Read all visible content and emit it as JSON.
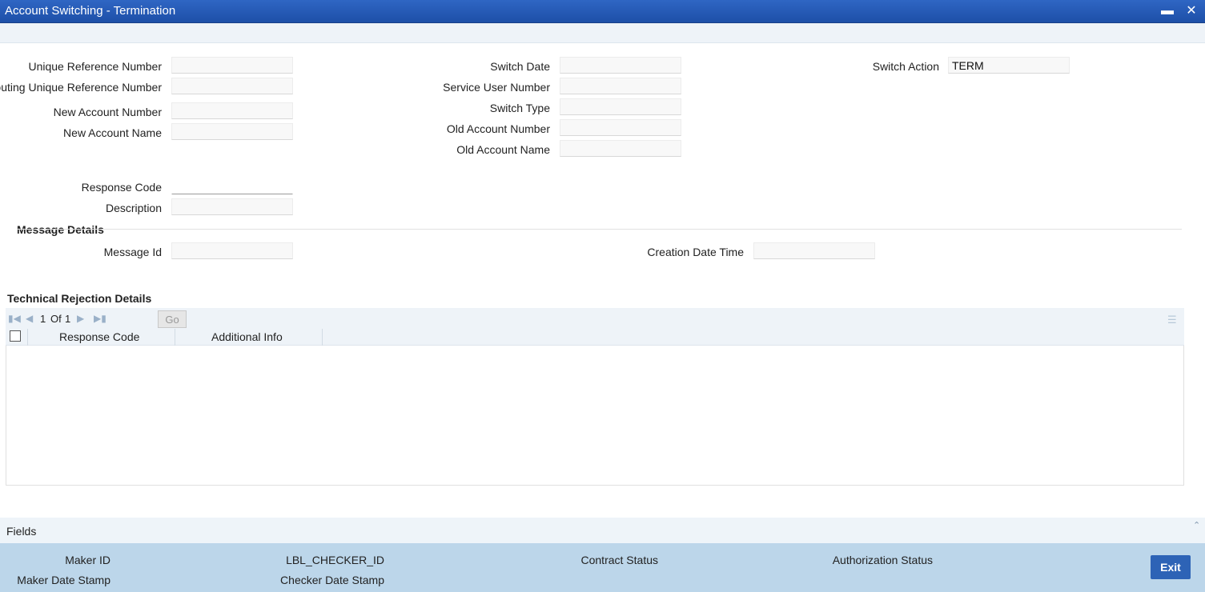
{
  "window": {
    "title": "Account Switching - Termination",
    "minimize_glyph": "▬",
    "close_glyph": "✕"
  },
  "form": {
    "unique_reference_number": {
      "label": "Unique Reference Number",
      "value": ""
    },
    "routing_unique_reference_number": {
      "label": "Routing Unique Reference Number",
      "value": ""
    },
    "new_account_number": {
      "label": "New Account Number",
      "value": ""
    },
    "new_account_name": {
      "label": "New Account Name",
      "value": ""
    },
    "switch_date": {
      "label": "Switch Date",
      "value": ""
    },
    "service_user_number": {
      "label": "Service User Number",
      "value": ""
    },
    "switch_type": {
      "label": "Switch Type",
      "value": ""
    },
    "old_account_number": {
      "label": "Old Account Number",
      "value": ""
    },
    "old_account_name": {
      "label": "Old Account Name",
      "value": ""
    },
    "switch_action": {
      "label": "Switch Action",
      "value": "TERM"
    },
    "response_code": {
      "label": "Response Code",
      "value": ""
    },
    "description": {
      "label": "Description",
      "value": ""
    }
  },
  "message_details": {
    "heading": "Message Details",
    "message_id": {
      "label": "Message Id",
      "value": ""
    },
    "creation_date_time": {
      "label": "Creation Date Time",
      "value": ""
    }
  },
  "technical_rejection": {
    "heading": "Technical Rejection Details",
    "pagination": {
      "current": "1",
      "of_label": "Of",
      "total": "1",
      "go_label": "Go"
    },
    "columns": [
      "Response Code",
      "Additional Info"
    ],
    "rows": []
  },
  "fields_bar": {
    "label": "Fields"
  },
  "footer": {
    "maker_id": "Maker ID",
    "maker_date_stamp": "Maker Date Stamp",
    "checker_id": "LBL_CHECKER_ID",
    "checker_date_stamp": "Checker Date Stamp",
    "contract_status": "Contract Status",
    "authorization_status": "Authorization Status",
    "exit_label": "Exit"
  }
}
